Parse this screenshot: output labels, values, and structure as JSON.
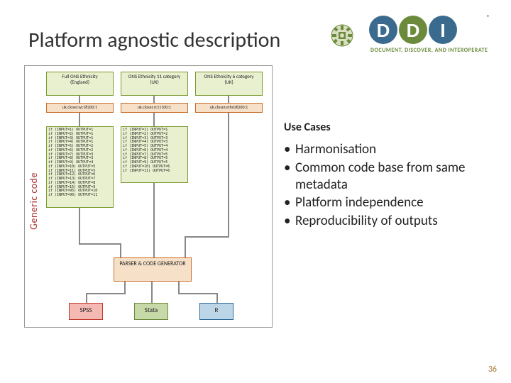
{
  "title": "Platform agnostic description",
  "logo": {
    "abbrev": "DDI",
    "tagline": "DOCUMENT, DISCOVER, AND INTEROPERATE",
    "registered": "®"
  },
  "diagram": {
    "vertical_label": "Generic code",
    "headers": [
      {
        "title": "Full ONS Ethnicity",
        "sub": "(England)"
      },
      {
        "title": "ONS Ethnicity 11 category",
        "sub": "(UK)"
      },
      {
        "title": "ONS Ethnicity 6 category",
        "sub": "(UK)"
      }
    ],
    "uris": [
      "uk.closer.wc18200:1",
      "uk.closer.rc11100:1",
      "uk.closer.ethc06200:1"
    ],
    "code_blocks": [
      "if (INPUT=1) OUTPUT=1\nif (INPUT=2) OUTPUT=1\nif (INPUT=3) OUTPUT=1\nif (INPUT=4) OUTPUT=1\nif (INPUT=5) OUTPUT=2\nif (INPUT=6) OUTPUT=2\nif (INPUT=7) OUTPUT=3\nif (INPUT=8) OUTPUT=3\nif (INPUT=9) OUTPUT=4\nif (INPUT=10) OUTPUT=5\nif (INPUT=11) OUTPUT=5\nif (INPUT=12) OUTPUT=6\nif (INPUT=13) OUTPUT=7\nif (INPUT=14) OUTPUT=8\nif (INPUT=15) OUTPUT=9\nif (INPUT=95) OUTPUT=10\nif (INPUT=96) OUTPUT=11",
      "if (INPUT=1) OUTPUT=1\nif (INPUT=2) OUTPUT=2\nif (INPUT=3) OUTPUT=3\nif (INPUT=4) OUTPUT=3\nif (INPUT=5) OUTPUT=4\nif (INPUT=6) OUTPUT=4\nif (INPUT=7) OUTPUT=5\nif (INPUT=8) OUTPUT=5\nif (INPUT=9) OUTPUT=5\nif (INPUT=10) OUTPUT=6\nif (INPUT=11) OUTPUT=6",
      ""
    ],
    "parser": "PARSER & CODE GENERATOR",
    "outputs": [
      "SPSS",
      "Stata",
      "R"
    ]
  },
  "usecases": {
    "heading": "Use Cases",
    "items": [
      "Harmonisation",
      "Common code base from same metadata",
      "Platform independence",
      "Reproducibility of outputs"
    ]
  },
  "page_number": "36"
}
